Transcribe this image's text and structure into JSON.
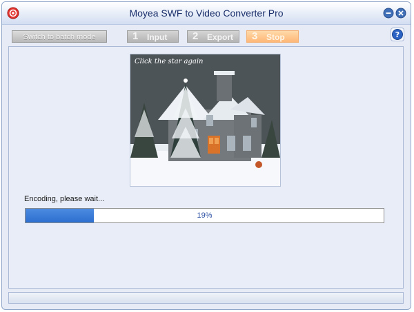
{
  "window": {
    "title": "Moyea SWF to Video Converter Pro"
  },
  "toolbar": {
    "batch_button": "Switch to batch mode",
    "steps": [
      {
        "num": "1",
        "label": "Input"
      },
      {
        "num": "2",
        "label": "Export"
      },
      {
        "num": "3",
        "label": "Stop"
      }
    ],
    "active_step": 3
  },
  "preview": {
    "caption": "Click the star again"
  },
  "encoding": {
    "status_text": "Encoding, please wait...",
    "progress": 0.19,
    "progress_text": "19%"
  },
  "colors": {
    "accent": "#2d6fd0",
    "active_step": "#ffb777",
    "title_text": "#1a2f6b"
  },
  "icons": {
    "app": "app-logo-icon",
    "minimize": "minimize-icon",
    "close": "close-icon",
    "help": "help-icon"
  }
}
